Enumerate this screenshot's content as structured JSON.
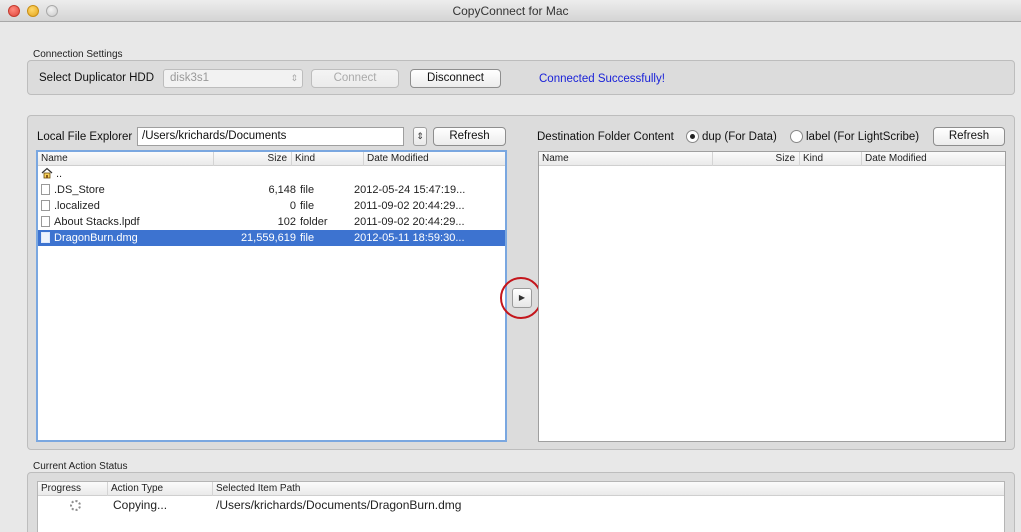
{
  "window": {
    "title": "CopyConnect for Mac"
  },
  "connection": {
    "group_label": "Connection Settings",
    "hdd_label": "Select Duplicator HDD",
    "hdd_value": "disk3s1",
    "connect_label": "Connect",
    "disconnect_label": "Disconnect",
    "status": "Connected Successfully!"
  },
  "local": {
    "label": "Local File Explorer",
    "path": "/Users/krichards/Documents",
    "refresh_label": "Refresh",
    "columns": {
      "name": "Name",
      "size": "Size",
      "kind": "Kind",
      "modified": "Date Modified"
    },
    "parent_label": "..",
    "rows": [
      {
        "name": ".DS_Store",
        "size": "6,148",
        "kind": "file",
        "modified": "2012-05-24 15:47:19..."
      },
      {
        "name": ".localized",
        "size": "0",
        "kind": "file",
        "modified": "2011-09-02 20:44:29..."
      },
      {
        "name": "About Stacks.lpdf",
        "size": "102",
        "kind": "folder",
        "modified": "2011-09-02 20:44:29..."
      },
      {
        "name": "DragonBurn.dmg",
        "size": "21,559,619",
        "kind": "file",
        "modified": "2012-05-11 18:59:30..."
      }
    ],
    "selected_index": 3
  },
  "destination": {
    "label": "Destination Folder Content",
    "option_dup": "dup (For Data)",
    "option_label": "label (For LightScribe)",
    "selected_option": "dup",
    "refresh_label": "Refresh",
    "columns": {
      "name": "Name",
      "size": "Size",
      "kind": "Kind",
      "modified": "Date Modified"
    }
  },
  "transfer": {
    "arrow_glyph": "▶"
  },
  "status_panel": {
    "group_label": "Current Action Status",
    "columns": {
      "progress": "Progress",
      "action": "Action Type",
      "path": "Selected Item Path"
    },
    "rows": [
      {
        "action": "Copying...",
        "path": "/Users/krichards/Documents/DragonBurn.dmg"
      }
    ]
  },
  "colors": {
    "status_ok": "#1a22d8",
    "selection": "#3d73d0",
    "highlight_ring": "#c4161c"
  }
}
